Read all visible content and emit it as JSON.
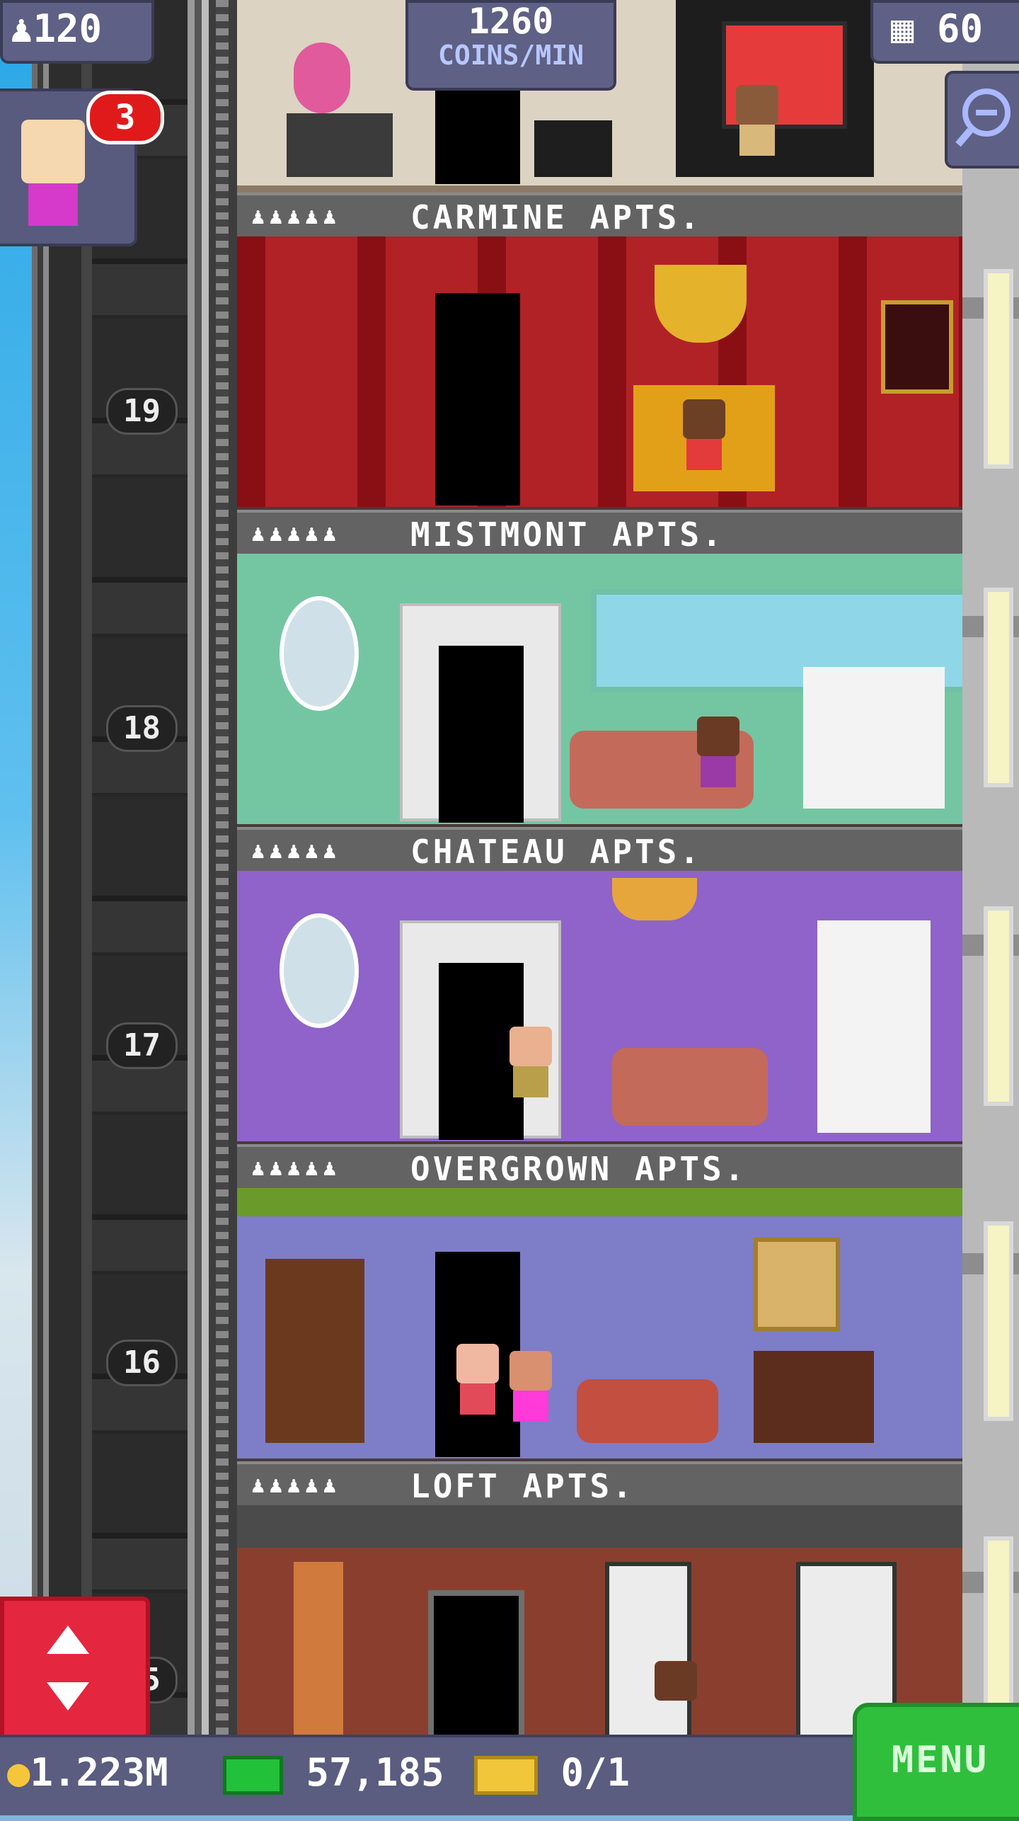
{
  "hud": {
    "population": "120",
    "coins_rate_value": "1260",
    "coins_rate_unit": "COINS/MIN",
    "floors": "60",
    "notification_count": "3"
  },
  "floors": [
    {
      "label": "CARMINE APTS.",
      "stars": "♟♟♟♟♟"
    },
    {
      "label": "MISTMONT APTS.",
      "stars": "♟♟♟♟♟"
    },
    {
      "label": "CHATEAU APTS.",
      "stars": "♟♟♟♟♟"
    },
    {
      "label": "OVERGROWN APTS.",
      "stars": "♟♟♟♟♟"
    },
    {
      "label": "LOFT APTS.",
      "stars": "♟♟♟♟♟"
    }
  ],
  "floor_numbers": [
    "19",
    "18",
    "17",
    "16",
    "15"
  ],
  "bottom_bar": {
    "coins": "1.223M",
    "bux": "57,185",
    "vip": "0/1",
    "menu_label": "MENU"
  },
  "colors": {
    "carmine": "#a11a1f",
    "mistmont": "#74c6a3",
    "chateau": "#8f63c9",
    "overgrown": "#7e7dc8",
    "loft": "#8a3f2e",
    "menu": "#2fbf3d",
    "elevator_button": "#e5263f"
  }
}
